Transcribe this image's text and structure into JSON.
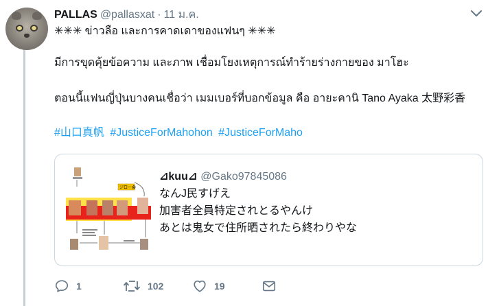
{
  "tweet": {
    "display_name": "PALLAS",
    "handle": "@pallasxat",
    "separator": "·",
    "time": "11 ม.ค.",
    "lines": [
      "✳✳✳ ข่าวลือ และการคาดเดาของแฟนๆ ✳✳✳",
      "มีการขุดคุ้ยข้อความ และภาพ เชื่อมโยงเหตุการณ์ทำร้ายร่างกายของ มาโฮะ",
      "ตอนนี้แฟนญี่ปุ่นบางคนเชื่อว่า เมมเบอร์ที่บอกข้อมูล คือ อายะคานิ Tano Ayaka 太野彩香"
    ],
    "hashtags": [
      "#山口真帆",
      "#JusticeForMahohon",
      "#JusticeForMaho"
    ]
  },
  "quote": {
    "display_name": "⊿kuu⊿",
    "handle": "@Gako97845086",
    "lines": [
      "なんJ民すげえ",
      "加害者全員特定されとるやんけ",
      "あとは鬼女で住所晒されたら終わりやな"
    ],
    "image_label": "ジロー会"
  },
  "actions": {
    "reply": {
      "icon": "reply-icon",
      "count": "1"
    },
    "retweet": {
      "icon": "retweet-icon",
      "count": "102"
    },
    "like": {
      "icon": "heart-icon",
      "count": "19"
    },
    "dm": {
      "icon": "envelope-icon"
    }
  },
  "colors": {
    "link": "#1da1f2",
    "secondary_text": "#657786",
    "thread_line": "#c4cfd6",
    "border": "#ccd6dd"
  }
}
